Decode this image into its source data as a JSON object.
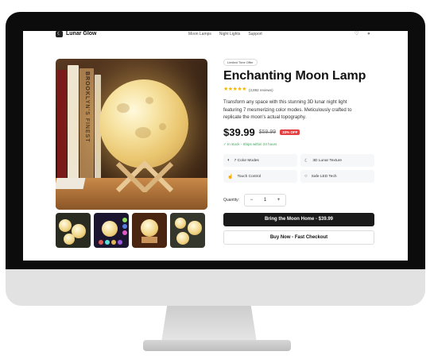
{
  "nav": {
    "brand": "Lunar Glow",
    "links": [
      "Moon Lamps",
      "Night Lights",
      "Support"
    ],
    "icons": [
      "heart-icon",
      "share-icon"
    ]
  },
  "product_image": {
    "book_spine_text": "BROOKLYN'S FINEST"
  },
  "product": {
    "badge": "Limited Time Offer",
    "title": "Enchanting Moon Lamp",
    "stars": "★★★★★",
    "reviews": "(3,892 reviews)",
    "description": "Transform any space with this stunning 3D lunar night light featuring 7 mesmerizing color modes. Meticulously crafted to replicate the moon's actual topography.",
    "price": "$39.99",
    "old_price": "$59.99",
    "discount": "33% OFF",
    "stock": "In stock - Ships within 24 hours",
    "features": [
      {
        "label": "7 Color Modes",
        "icon": "palette-icon"
      },
      {
        "label": "3D Lunar Texture",
        "icon": "moon-icon"
      },
      {
        "label": "Touch Control",
        "icon": "touch-icon"
      },
      {
        "label": "Safe LED Tech",
        "icon": "circle-icon"
      }
    ],
    "quantity_label": "Quantity:",
    "quantity": "1",
    "minus": "−",
    "plus": "+",
    "primary_cta": "Bring the Moon Home - $39.99",
    "secondary_cta": "Buy Now - Fast Checkout"
  },
  "colors": {
    "accent": "#1a1a1a",
    "discount": "#e54040",
    "stock": "#3aa55d",
    "stars": "#f2b705"
  }
}
